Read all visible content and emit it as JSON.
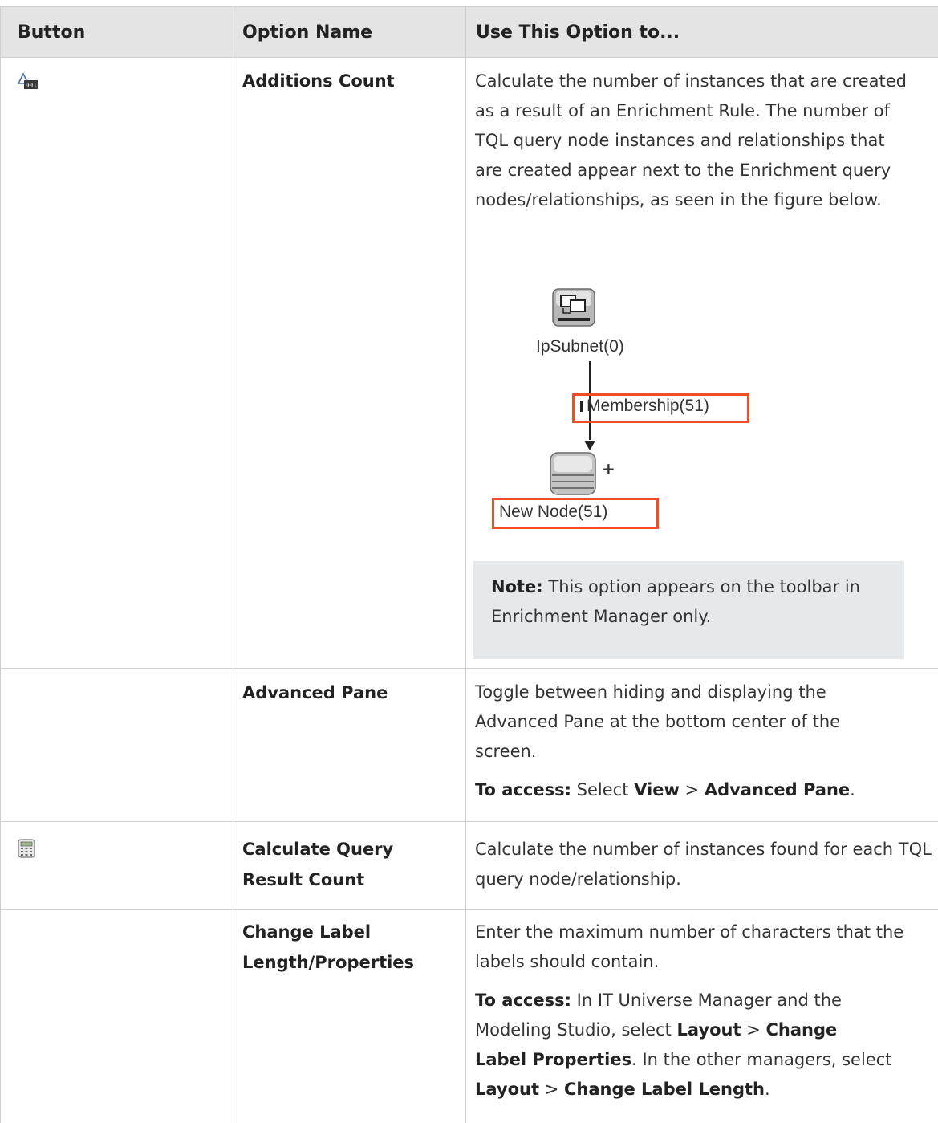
{
  "table": {
    "headers": [
      "Button",
      "Option Name",
      "Use This Option to..."
    ],
    "rows": [
      {
        "icon": "additions-count-icon",
        "option": "Additions Count",
        "description": "Calculate the number of instances that are created as a result of an Enrichment Rule. The number of TQL query node instances and relationships that are created appear next to the Enrichment query nodes/relationships, as seen in the figure below.",
        "figure": {
          "top_node_label": "IpSubnet(0)",
          "edge_label": "Membership(51)",
          "bottom_node_label": "New Node(51)",
          "plus_sign": "+"
        },
        "note": {
          "label": "Note:",
          "text": " This option appears on the toolbar in Enrichment Manager only."
        }
      },
      {
        "icon": "",
        "option": "Advanced Pane",
        "description": "Toggle between hiding and displaying the Advanced Pane at the bottom center of the screen.",
        "access": {
          "label": "To access:",
          "parts": [
            " Select ",
            "View",
            " > ",
            "Advanced Pane",
            "."
          ]
        }
      },
      {
        "icon": "calculator-icon",
        "option": "Calculate Query Result Count",
        "option_lines": [
          "Calculate Query",
          "Result Count"
        ],
        "description": "Calculate the number of instances found for each TQL query node/relationship."
      },
      {
        "icon": "",
        "option": "Change Label Length/Properties",
        "option_lines": [
          "Change Label",
          "Length/Properties"
        ],
        "description": "Enter the maximum number of characters that the labels should contain.",
        "access": {
          "label": "To access:",
          "parts": [
            " In IT Universe Manager and the Modeling Studio, select ",
            "Layout",
            " > ",
            "Change Label Properties",
            ". In the other managers, select ",
            "Layout",
            " > ",
            "Change Label Length",
            "."
          ]
        }
      }
    ]
  }
}
